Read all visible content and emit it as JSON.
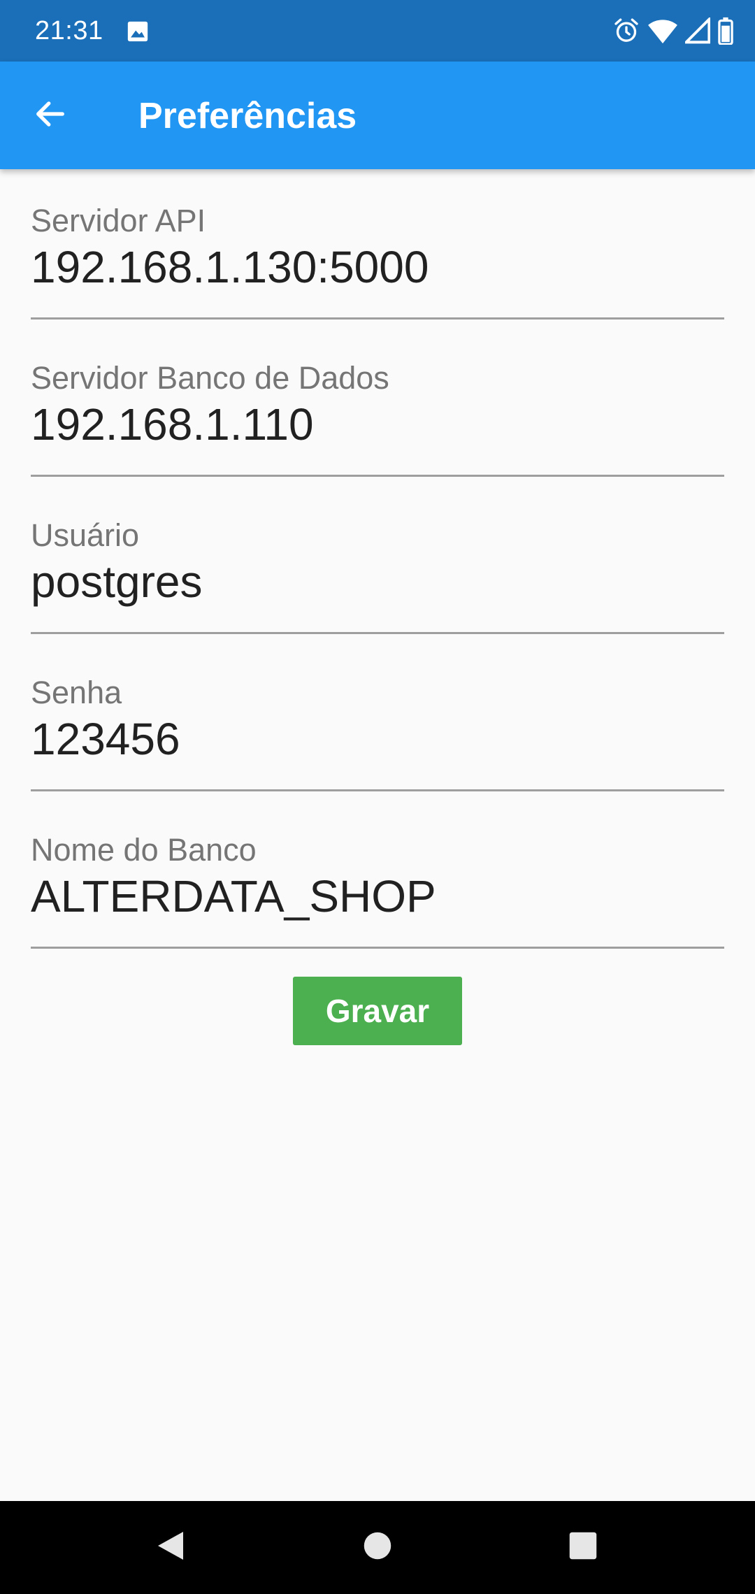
{
  "status_bar": {
    "time": "21:31",
    "icons": [
      "image-icon",
      "alarm-icon",
      "wifi-icon",
      "signal-icon",
      "battery-icon"
    ]
  },
  "app_bar": {
    "title": "Preferências",
    "back_icon": "arrow-back-icon",
    "color": "#2196f3"
  },
  "form": {
    "fields": [
      {
        "label": "Servidor API",
        "value": "192.168.1.130:5000"
      },
      {
        "label": "Servidor Banco de Dados",
        "value": "192.168.1.110"
      },
      {
        "label": "Usuário",
        "value": "postgres"
      },
      {
        "label": "Senha",
        "value": "123456"
      },
      {
        "label": "Nome do Banco",
        "value": "ALTERDATA_SHOP"
      }
    ],
    "save_label": "Gravar",
    "save_color": "#4caf50"
  },
  "nav_bar": {
    "icons": [
      "back-triangle-icon",
      "home-circle-icon",
      "recents-square-icon"
    ]
  }
}
